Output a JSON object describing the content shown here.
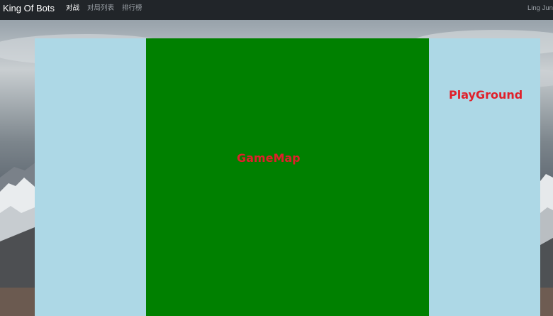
{
  "navbar": {
    "brand": "King Of Bots",
    "links": [
      "对战",
      "对局列表",
      "排行榜"
    ],
    "active_link": "对战",
    "user": "Ling Jun"
  },
  "playground": {
    "label": "PlayGround",
    "color": "#add8e6"
  },
  "gamemap": {
    "label": "GameMap",
    "color": "#008000"
  },
  "colors": {
    "navbar_bg": "#212529",
    "label_red": "#e0202a"
  }
}
